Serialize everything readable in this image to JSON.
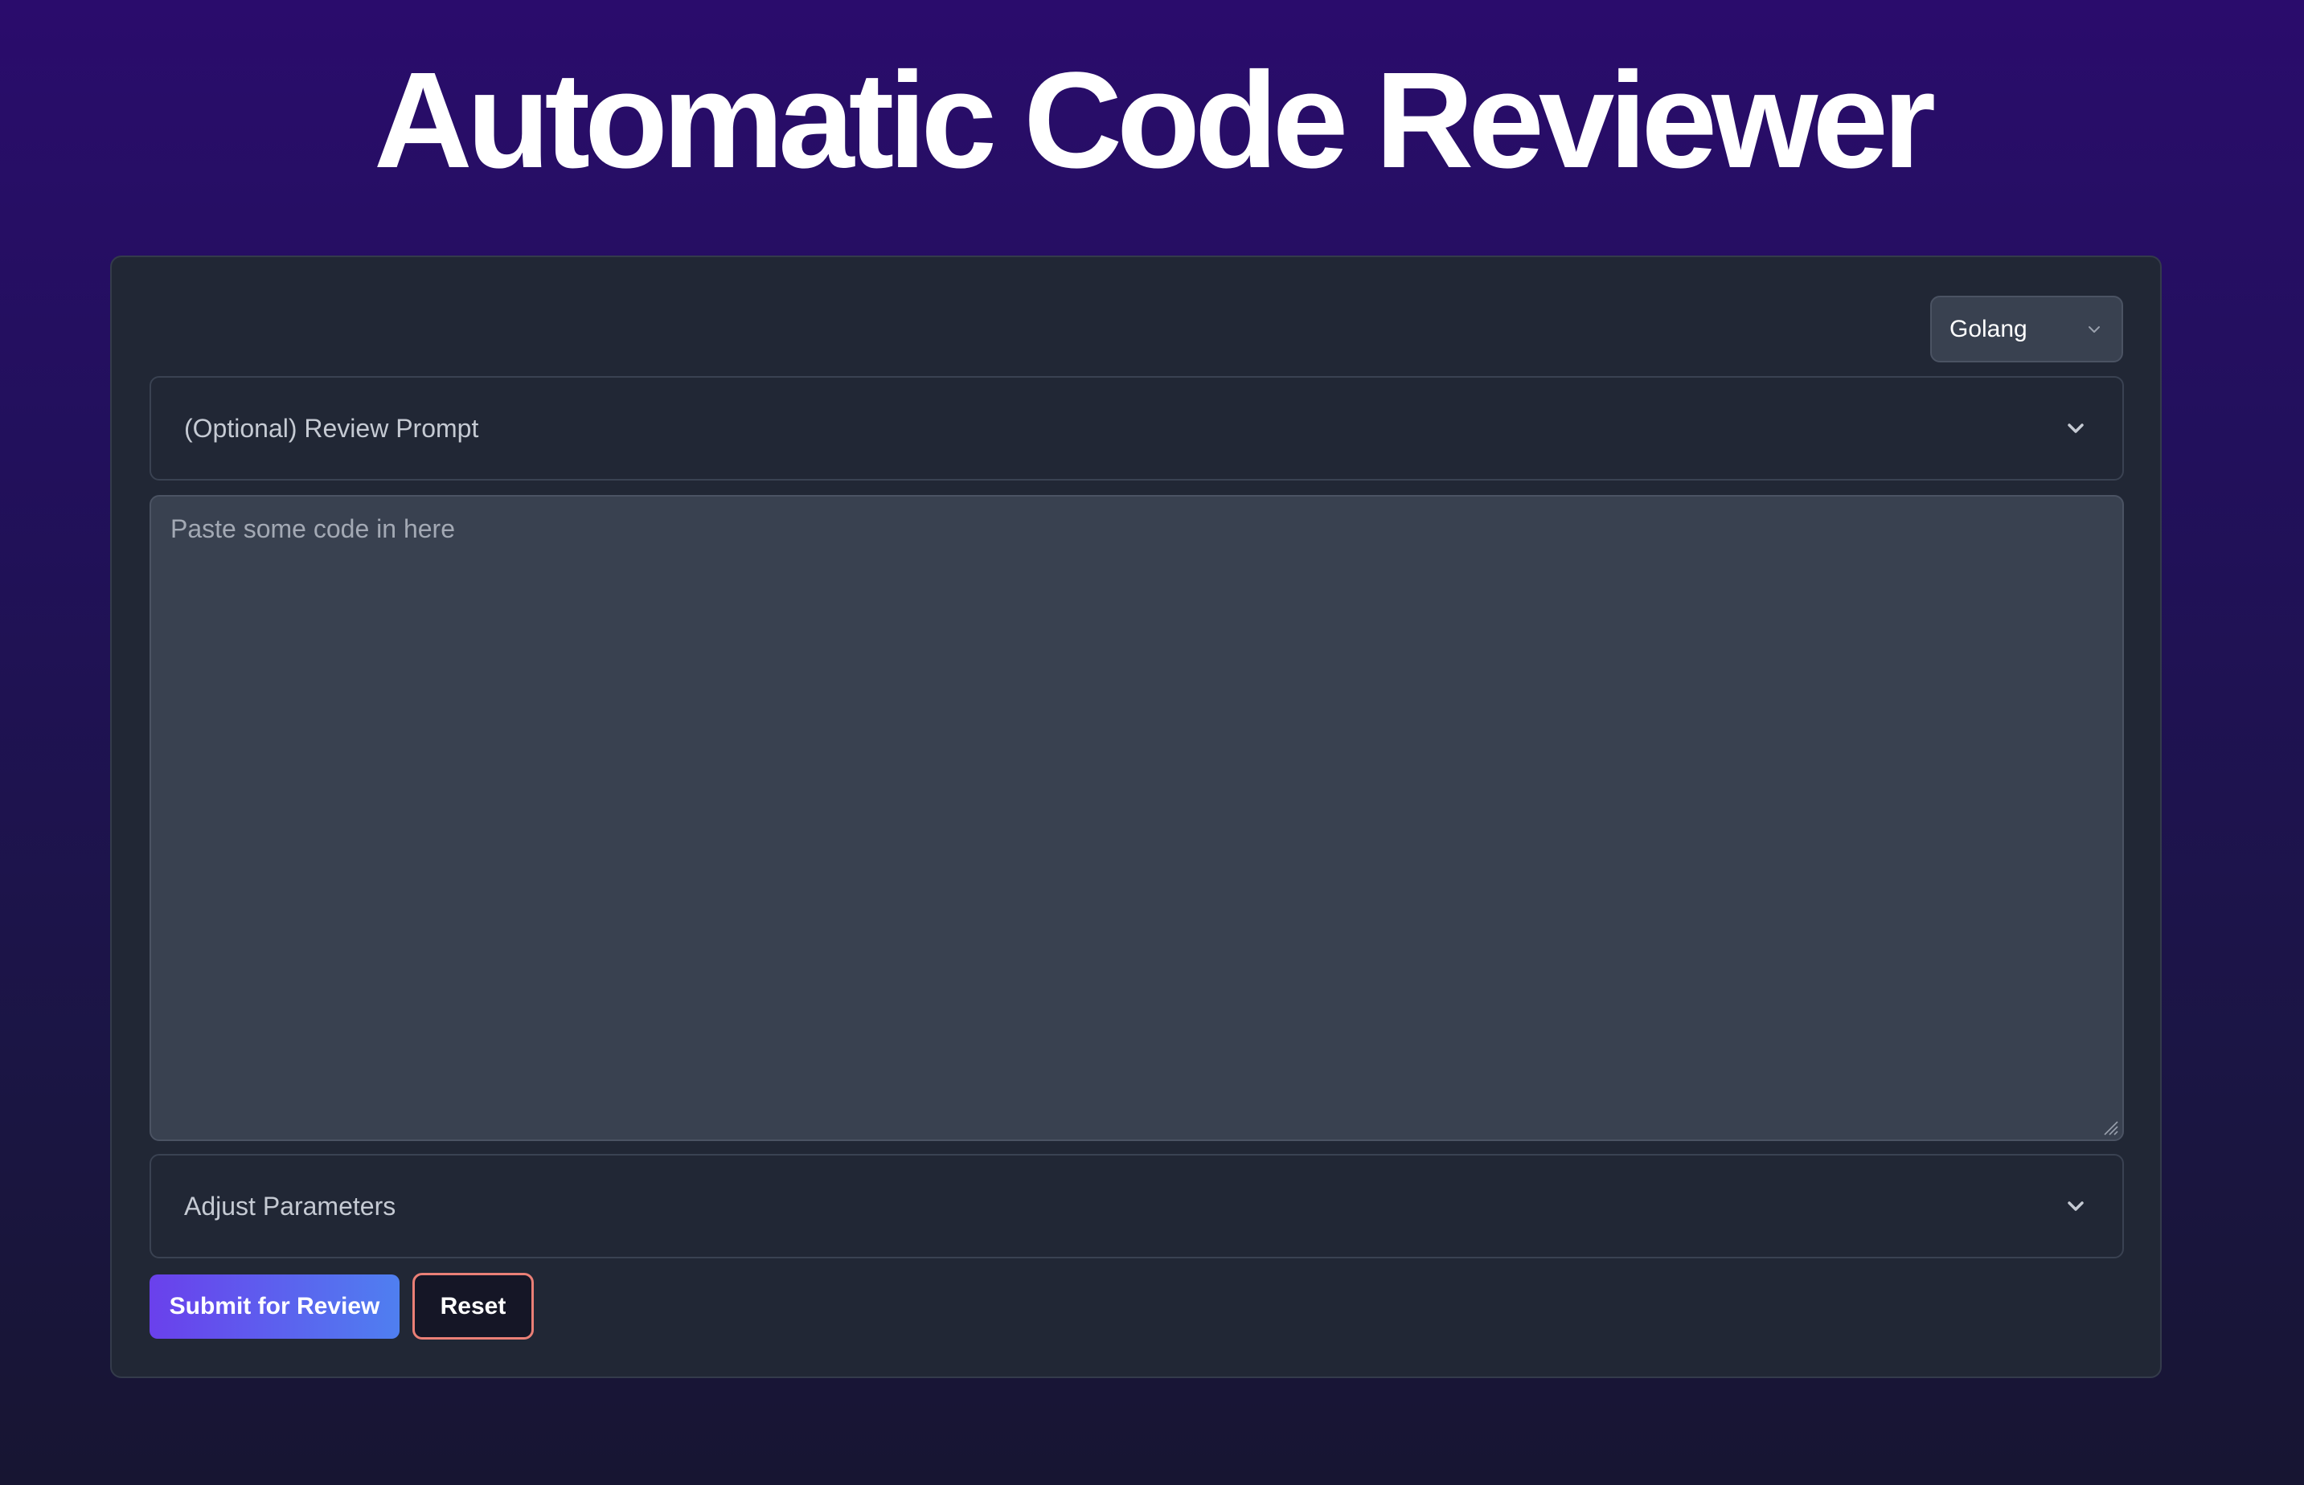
{
  "header": {
    "title": "Automatic Code Reviewer"
  },
  "language_select": {
    "value": "Golang",
    "icon": "chevron-down-icon"
  },
  "review_prompt": {
    "label": "(Optional) Review Prompt",
    "icon": "chevron-down-icon"
  },
  "code_input": {
    "placeholder": "Paste some code in here",
    "value": ""
  },
  "parameters": {
    "label": "Adjust Parameters",
    "icon": "chevron-down-icon"
  },
  "actions": {
    "submit_label": "Submit for Review",
    "reset_label": "Reset"
  },
  "colors": {
    "background_top": "#2a0c6c",
    "background_bottom": "#171532",
    "card": "#212735",
    "input": "#394150",
    "submit_gradient_start": "#6a40ec",
    "submit_gradient_end": "#4f7ff0",
    "reset_border": "#ea7f76"
  }
}
